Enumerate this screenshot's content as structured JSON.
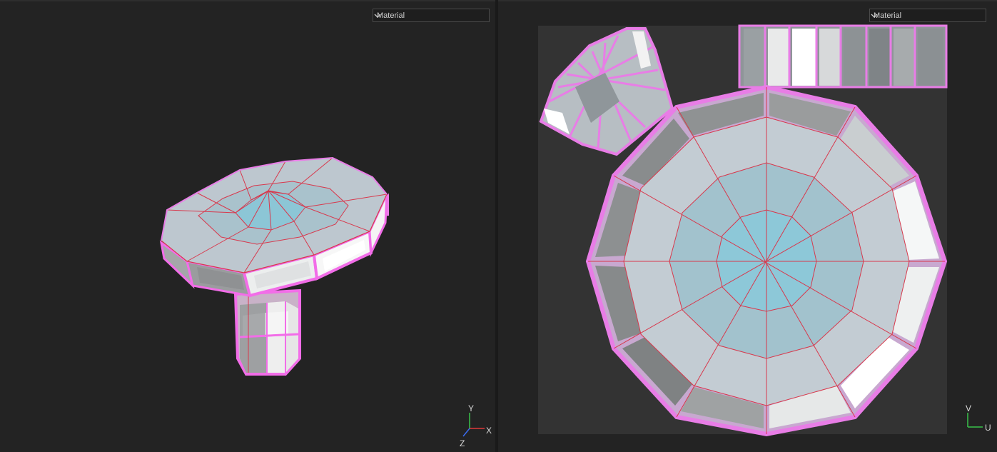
{
  "viewport_3d": {
    "shading_dropdown": {
      "selected": "Material"
    },
    "axis_gizmo": {
      "y_label": "Y",
      "x_label": "X",
      "z_label": "Z"
    }
  },
  "viewport_uv": {
    "shading_dropdown": {
      "selected": "Material"
    },
    "axis_gizmo": {
      "v_label": "V",
      "u_label": "U"
    }
  },
  "colors": {
    "background": "#232323",
    "uv_canvas": "#333333",
    "seam_pink": "#e87de6",
    "edge_red": "#d8384c",
    "surface_blue": "#8fcbd8",
    "surface_grey": "#bfc8ce"
  },
  "icons": [
    "chevron-down-icon",
    "axis-gizmo-icon",
    "uv-axis-icon"
  ]
}
